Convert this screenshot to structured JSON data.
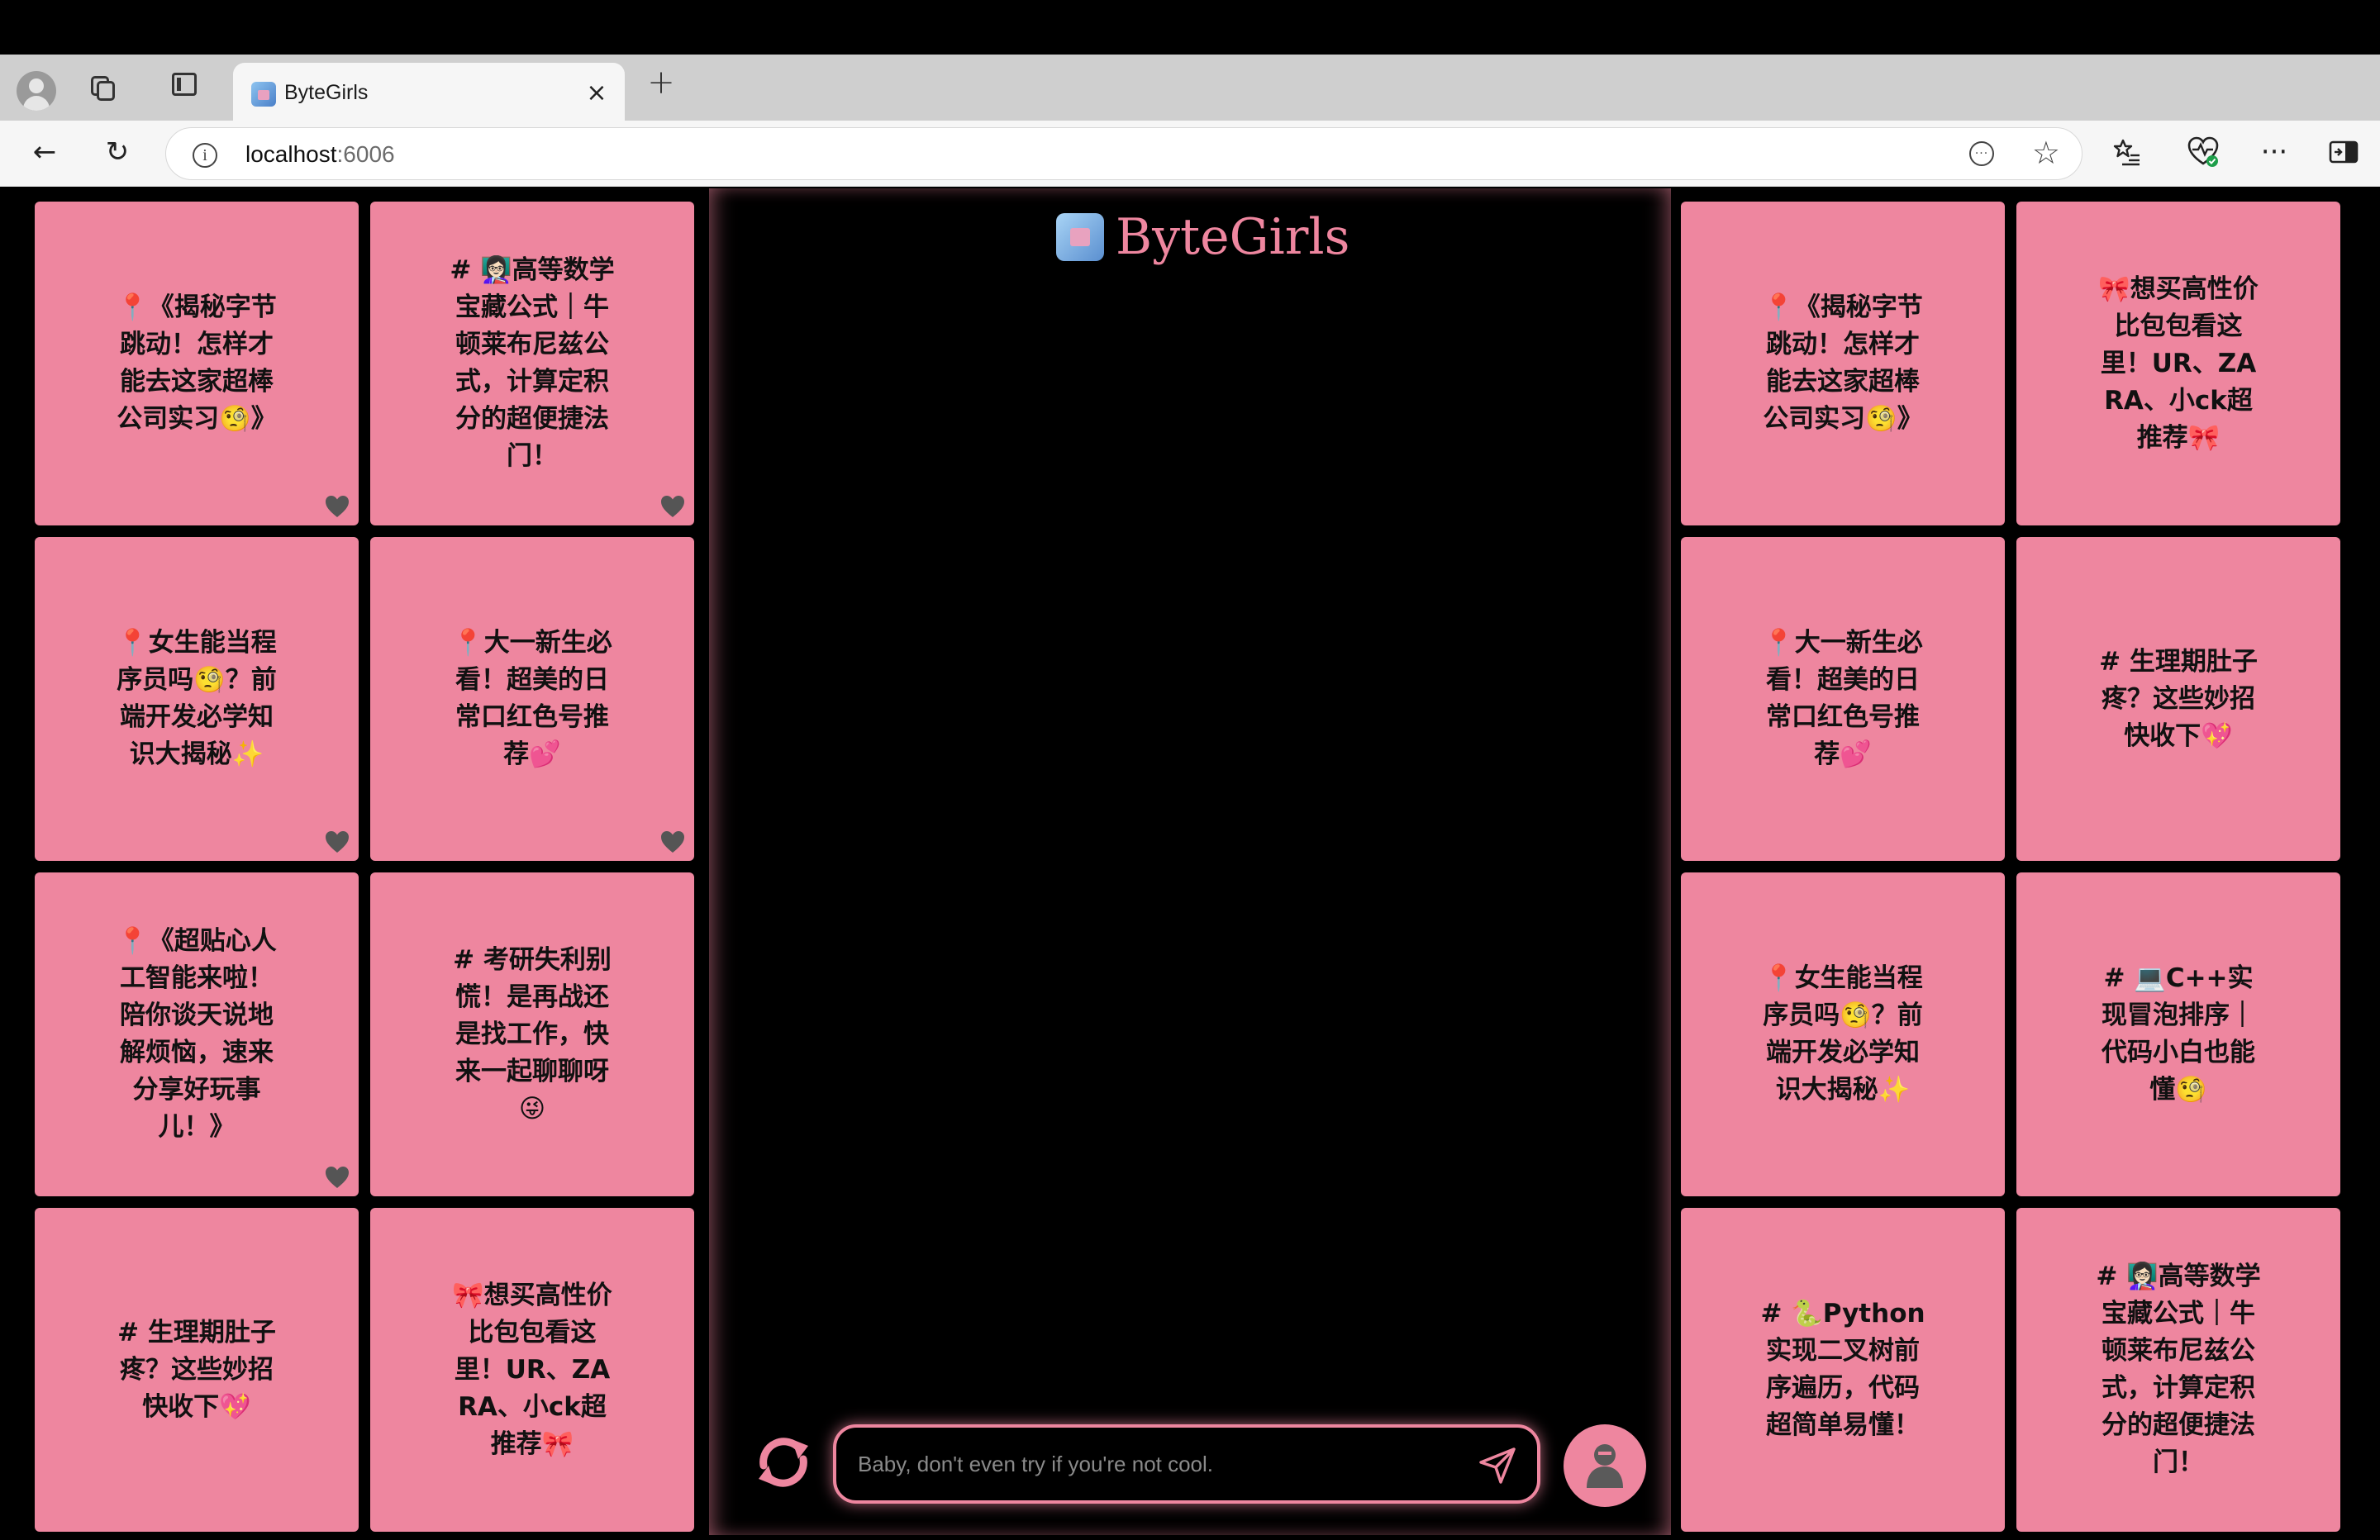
{
  "browser": {
    "tab_title": "ByteGirls",
    "close_glyph": "×",
    "new_tab_glyph": "+",
    "url_host": "localhost",
    "url_port": ":6006",
    "back_glyph": "←",
    "reload_glyph": "↻",
    "favorites_glyph": "☆",
    "more_glyph": "···",
    "info_glyph": "i",
    "omni_more_glyph": "···"
  },
  "app": {
    "name": "ByteGirls",
    "chat_placeholder": "Baby, don't even try if you're not cool.",
    "accent_color": "#ee869f"
  },
  "left_cards": [
    {
      "text": "📍《揭秘字节跳动！怎样才能去这家超棒公司实习🧐》",
      "liked": true
    },
    {
      "text": "# 👩🏻‍🏫高等数学宝藏公式｜牛顿莱布尼兹公式，计算定积分的超便捷法门！",
      "liked": true
    },
    {
      "text": "📍女生能当程序员吗🧐？前端开发必学知识大揭秘✨",
      "liked": true
    },
    {
      "text": "📍大一新生必看！超美的日常口红色号推荐💕",
      "liked": true
    },
    {
      "text": "📍《超贴心人工智能来啦！陪你谈天说地解烦恼，速来分享好玩事儿！》",
      "liked": true
    },
    {
      "text": "# 考研失利别慌！是再战还是找工作，快来一起聊聊呀😜",
      "liked": false
    },
    {
      "text": "# 生理期肚子疼？这些妙招快收下💖",
      "liked": false
    },
    {
      "text": "🎀想买高性价比包包看这里！UR、ZARA、小ck超推荐🎀",
      "liked": false
    }
  ],
  "right_cards": [
    {
      "text": "📍《揭秘字节跳动！怎样才能去这家超棒公司实习🧐》",
      "liked": false
    },
    {
      "text": "🎀想买高性价比包包看这里！UR、ZARA、小ck超推荐🎀",
      "liked": false
    },
    {
      "text": "📍大一新生必看！超美的日常口红色号推荐💕",
      "liked": false
    },
    {
      "text": "# 生理期肚子疼？这些妙招快收下💖",
      "liked": false
    },
    {
      "text": "📍女生能当程序员吗🧐？前端开发必学知识大揭秘✨",
      "liked": false
    },
    {
      "text": "# 💻C++实现冒泡排序｜代码小白也能懂🧐",
      "liked": false
    },
    {
      "text": "# 🐍Python实现二叉树前序遍历，代码超简单易懂！",
      "liked": false
    },
    {
      "text": "# 👩🏻‍🏫高等数学宝藏公式｜牛顿莱布尼兹公式，计算定积分的超便捷法门！",
      "liked": false
    }
  ]
}
